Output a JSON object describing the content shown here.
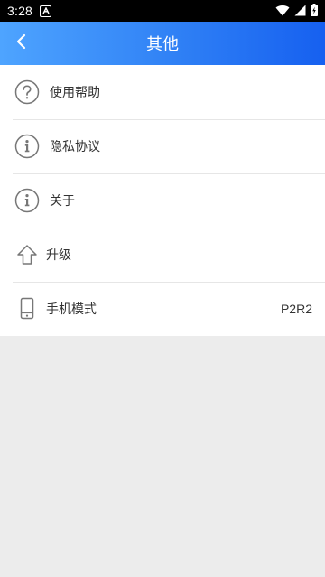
{
  "status_bar": {
    "time": "3:28",
    "notification_icon": "a-icon",
    "icons": [
      "wifi-icon",
      "signal-icon",
      "battery-charging-icon"
    ]
  },
  "header": {
    "title": "其他",
    "back_icon": "chevron-left-icon",
    "gradient": [
      "#4ea4ff",
      "#1660f0"
    ]
  },
  "menu": {
    "items": [
      {
        "label": "使用帮助",
        "icon": "question-circle-icon"
      },
      {
        "label": "隐私协议",
        "icon": "info-circle-icon"
      },
      {
        "label": "关于",
        "icon": "info-circle-icon"
      },
      {
        "label": "升级",
        "icon": "arrow-up-outline-icon"
      },
      {
        "label": "手机模式",
        "icon": "phone-icon",
        "value": "P2R2"
      }
    ]
  },
  "colors": {
    "background": "#ececec",
    "list_background": "#ffffff",
    "text": "#333333",
    "icon_gray": "#777777"
  }
}
